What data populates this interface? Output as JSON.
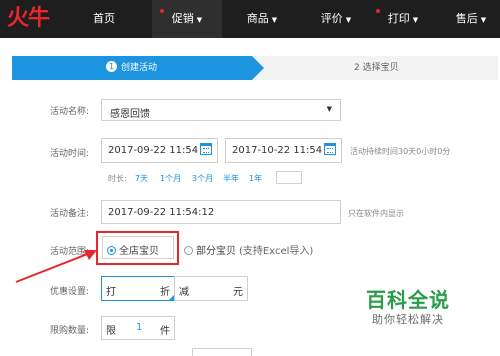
{
  "brand": {
    "logo_text": "火牛",
    "accent": "#e8262b",
    "primary": "#1c94e0"
  },
  "nav": {
    "home": "首页",
    "promo": "促销",
    "goods": "商品",
    "review": "评价",
    "print": "打印",
    "aftersale": "售后"
  },
  "steps": {
    "step1_num": "1",
    "step1_label": "创建活动",
    "step2_label": "2  选择宝贝"
  },
  "form": {
    "name_label": "活动名称:",
    "name_value": "感恩回馈",
    "time_label": "活动时间:",
    "start": "2017-09-22 11:54",
    "end": "2017-10-22 11:54",
    "time_hint": "活动持续时间30天0小时0分",
    "duration_label": "时长:",
    "durations": [
      "7天",
      "1个月",
      "3个月",
      "半年",
      "1年"
    ],
    "note_label": "活动备注:",
    "note_value": "2017-09-22 11:54:12",
    "note_hint": "只在软件内显示",
    "scope_label": "活动范围:",
    "scope_all": "全店宝贝",
    "scope_part": "部分宝贝",
    "scope_part_hint": "(支持Excel导入)",
    "discount_label": "优惠设置:",
    "discount_a": "打",
    "discount_a_unit": "折",
    "discount_b": "减",
    "discount_b_unit": "元",
    "limit_label": "限购数量:",
    "limit_prefix": "限",
    "limit_value": "1",
    "limit_unit": "件"
  },
  "watermark": {
    "title": "百科全说",
    "subtitle": "助你轻松解决"
  }
}
